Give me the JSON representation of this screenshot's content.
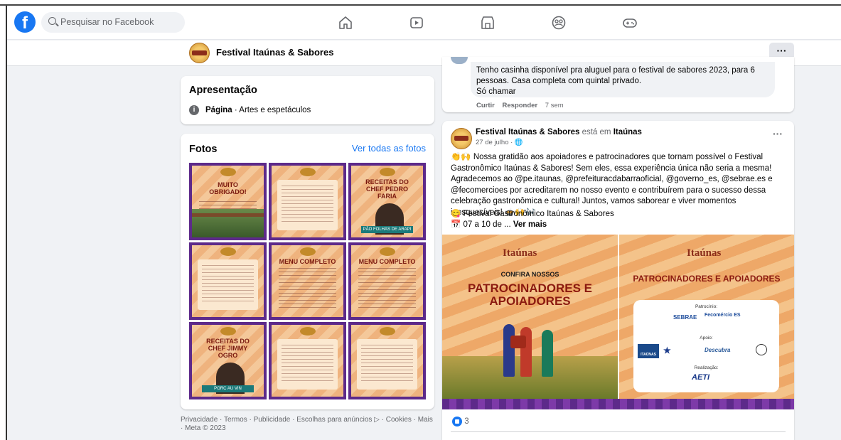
{
  "topbar": {
    "logo": "f",
    "search_placeholder": "Pesquisar no Facebook",
    "nav_icons": [
      "home-icon",
      "video-icon",
      "marketplace-icon",
      "groups-icon",
      "gaming-icon"
    ]
  },
  "page_header": {
    "name": "Festival Itaúnas & Sabores",
    "more": "···"
  },
  "intro": {
    "title": "Apresentação",
    "category_bold": "Página",
    "category_rest": " · Artes e espetáculos"
  },
  "photos": {
    "title": "Fotos",
    "see_all": "Ver todas as fotos",
    "tiles": [
      {
        "head": "MUITO OBRIGADO!"
      },
      {
        "head": ""
      },
      {
        "head": "RECEITAS DO CHEF PEDRO FARIA",
        "banner": "PÃO FOLHAS DE ARAPI"
      },
      {
        "head": ""
      },
      {
        "head": "MENU COMPLETO"
      },
      {
        "head": "MENU COMPLETO"
      },
      {
        "head": "RECEITAS DO CHEF JIMMY OGRO",
        "banner": "PORC AU VIN"
      },
      {
        "head": ""
      },
      {
        "head": ""
      }
    ]
  },
  "footer": "Privacidade · Termos · Publicidade · Escolhas para anúncios ▷ · Cookies · Mais · Meta © 2023",
  "comment": {
    "text_line1": "Tenho casinha disponível pra aluguel para o festival de sabores 2023, para 6",
    "text_line2": "pessoas. Casa completa com quintal privado.",
    "text_line3": "Só chamar",
    "like": "Curtir",
    "reply": "Responder",
    "time": "7 sem"
  },
  "post": {
    "author": "Festival Itaúnas & Sabores",
    "at_text": " está em ",
    "place": "Itaúnas",
    "date": "27 de julho · 🌐",
    "more": "···",
    "body": "👏🙌 Nossa gratidão aos apoiadores e patrocinadores que tornam possível o Festival Gastronômico Itaúnas & Sabores! Sem eles, essa experiência única não seria a mesma! Agradecemos ao @pe.itaunas, @prefeituracdabarraoficial, @governo_es, @sebrae.es e @fecomercioes por acreditarem no nosso evento e contribuírem para o sucesso dessa celebração gastronômica e cultural! Juntos, vamos saborear e viver momentos inesquecíveis! 🍲🙌🎶",
    "line_event": "😋 Festival Gastronômico Itaúnas & Sabores",
    "line_date": "📅 07 a 10 de ... ",
    "see_more": "Ver mais",
    "image_left": {
      "brand": "Itaúnas",
      "subtitle": "CONFIRA NOSSOS",
      "title": "PATROCINADORES E APOIADORES"
    },
    "image_right": {
      "brand": "Itaúnas",
      "title": "PATROCINADORES E APOIADORES",
      "label_patrocinio": "Patrocínio:",
      "label_apoio": "Apoio:",
      "label_realizacao": "Realização:",
      "logo_sebrae": "SEBRAE",
      "logo_fecomercio": "Fecomércio ES",
      "logo_itaunas": "ITAÚNAS",
      "logo_descubra": "Descubra",
      "logo_aeti": "AETI"
    },
    "reactions_count": "3"
  },
  "colors": {
    "brand": "#1877f2",
    "frame": "#5d2a8a"
  }
}
